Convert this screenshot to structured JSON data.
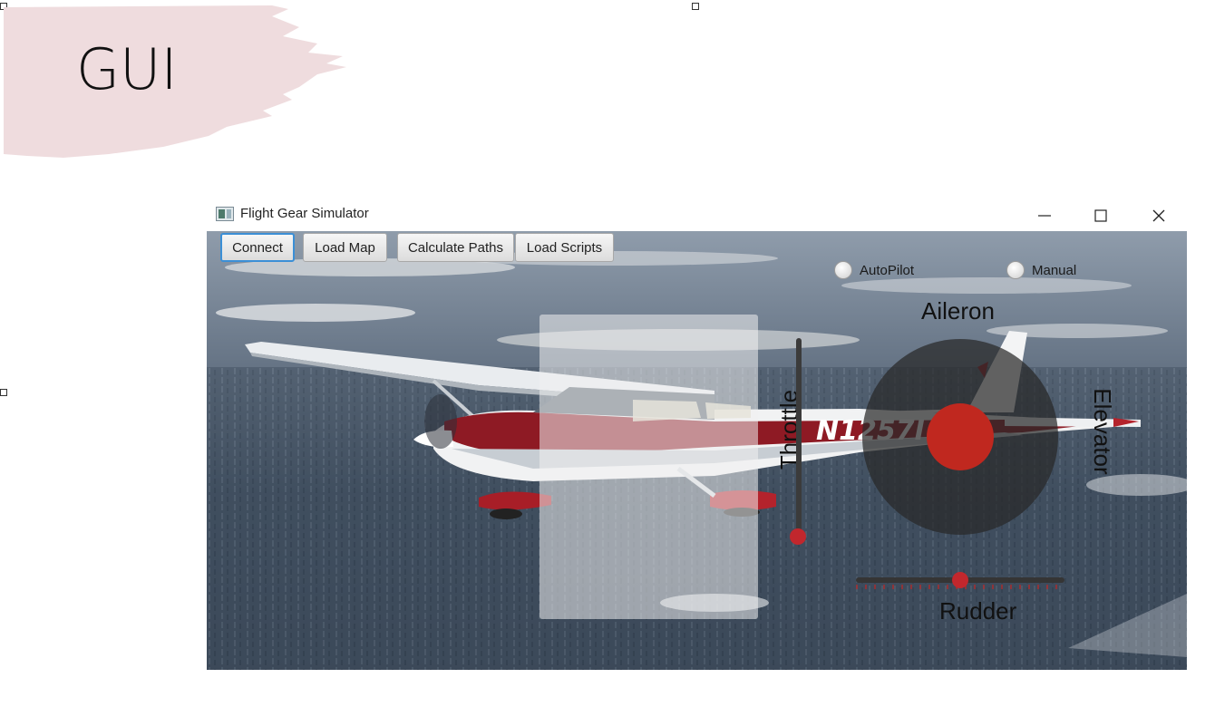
{
  "slide": {
    "title": "GUI",
    "brush_color": "#efdcde"
  },
  "window": {
    "title": "Flight Gear Simulator",
    "icons": {
      "app": "app-window-icon",
      "minimize": "minimize-icon",
      "maximize": "maximize-icon",
      "close": "close-icon"
    }
  },
  "toolbar": {
    "connect_label": "Connect",
    "load_map_label": "Load Map",
    "calculate_paths_label": "Calculate Paths",
    "load_scripts_label": "Load Scripts",
    "focused_color": "#3b8fd6"
  },
  "mode": {
    "autopilot_label": "AutoPilot",
    "manual_label": "Manual"
  },
  "controls": {
    "throttle_label": "Throttle",
    "throttle_value": 0.0,
    "aileron_label": "Aileron",
    "elevator_label": "Elevator",
    "aileron_value": 0.0,
    "elevator_value": 0.0,
    "rudder_label": "Rudder",
    "rudder_value": 0.0,
    "accent_color": "#c1272d"
  }
}
